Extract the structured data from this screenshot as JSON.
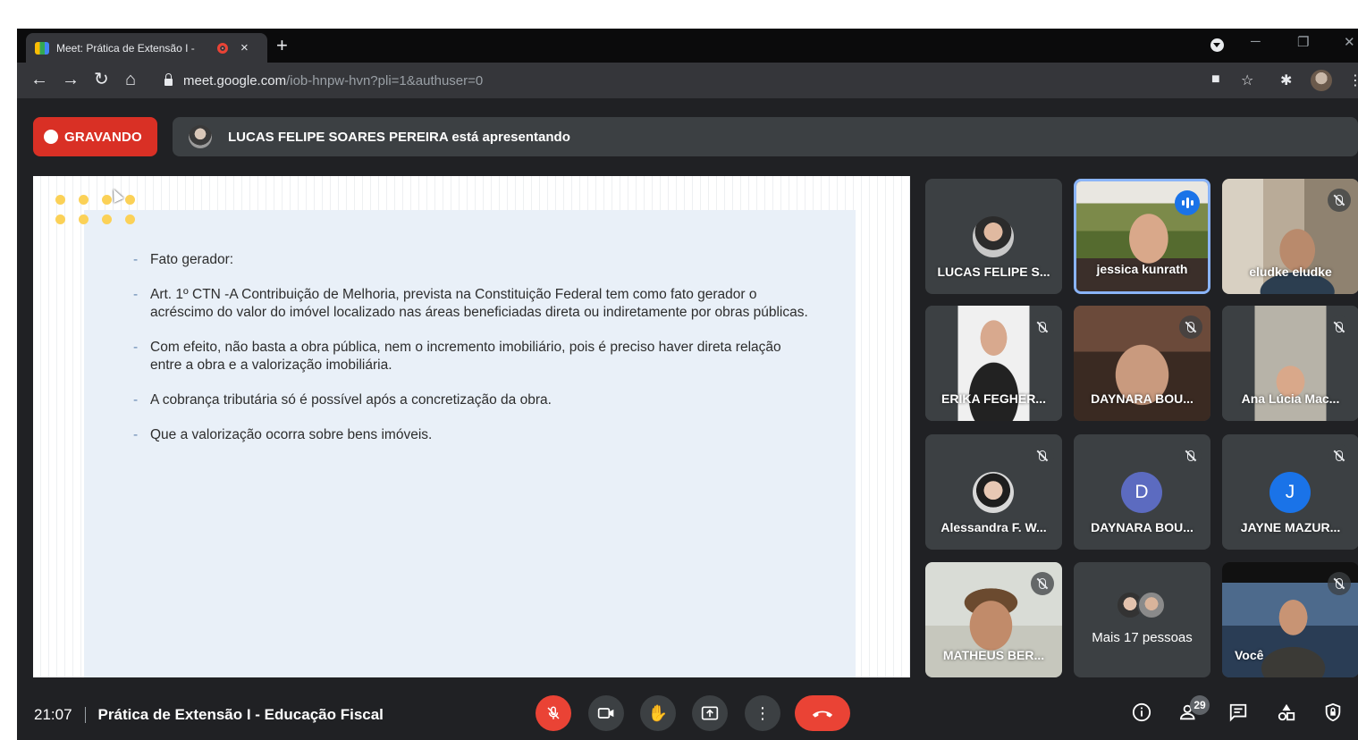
{
  "browser": {
    "tab_title": "Meet: Prática de Extensão I -",
    "tab_close": "×",
    "new_tab": "+",
    "url_host": "meet.google.com",
    "url_path": "/iob-hnpw-hvn?pli=1&authuser=0"
  },
  "meet": {
    "recording_label": "GRAVANDO",
    "presenter_text": "LUCAS FELIPE SOARES PEREIRA está apresentando",
    "slide": {
      "bullets": [
        "Fato gerador:",
        "Art. 1º CTN -A Contribuição de Melhoria, prevista na Constituição Federal tem como fato gerador o acréscimo do valor do imóvel localizado nas áreas beneficiadas direta ou indiretamente por obras públicas.",
        "Com efeito, não basta a obra pública, nem o incremento imobiliário, pois é preciso haver direta relação entre a obra e a valorização imobiliária.",
        "A cobrança tributária só é possível após a concretização da obra.",
        "Que a valorização ocorra sobre bens imóveis."
      ]
    },
    "participants": [
      {
        "name": "LUCAS FELIPE S...",
        "muted": false
      },
      {
        "name": "jessica kunrath",
        "speaking": true
      },
      {
        "name": "eludke eludke",
        "muted": true
      },
      {
        "name": "ERIKA FEGHER...",
        "muted": true
      },
      {
        "name": "DAYNARA BOU...",
        "muted": true
      },
      {
        "name": "Ana Lúcia Mac...",
        "muted": true
      },
      {
        "name": "Alessandra F. W...",
        "muted": true
      },
      {
        "name": "DAYNARA BOU...",
        "initial": "D",
        "color": "#5c6bc0",
        "muted": true
      },
      {
        "name": "JAYNE MAZUR...",
        "initial": "J",
        "color": "#1a73e8",
        "muted": true
      },
      {
        "name": "MATHEUS BER...",
        "muted": true
      },
      {
        "name": "Mais 17 pessoas"
      },
      {
        "name": "Você",
        "muted": true
      }
    ],
    "footer": {
      "time": "21:07",
      "meeting_title": "Prática de Extensão I - Educação Fiscal",
      "people_count": "29"
    }
  }
}
